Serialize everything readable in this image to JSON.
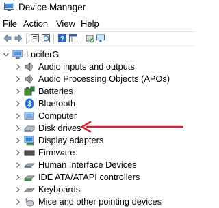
{
  "window": {
    "title": "Device Manager"
  },
  "menu": [
    "File",
    "Action",
    "View",
    "Help"
  ],
  "toolbar": {
    "icons": [
      "back-icon",
      "forward-icon",
      "properties-icon",
      "refresh-icon",
      "help-icon",
      "console-icon",
      "update-driver-icon",
      "monitor-icon"
    ]
  },
  "tree": {
    "root": "LuciferG",
    "items": [
      {
        "label": "Audio inputs and outputs",
        "icon": "speaker-icon"
      },
      {
        "label": "Audio Processing Objects (APOs)",
        "icon": "speaker-icon"
      },
      {
        "label": "Batteries",
        "icon": "battery-icon"
      },
      {
        "label": "Bluetooth",
        "icon": "bluetooth-icon"
      },
      {
        "label": "Computer",
        "icon": "computer-icon"
      },
      {
        "label": "Disk drives",
        "icon": "disk-drive-icon"
      },
      {
        "label": "Display adapters",
        "icon": "display-adapter-icon"
      },
      {
        "label": "Firmware",
        "icon": "firmware-icon"
      },
      {
        "label": "Human Interface Devices",
        "icon": "hid-icon"
      },
      {
        "label": "IDE ATA/ATAPI controllers",
        "icon": "ide-controller-icon"
      },
      {
        "label": "Keyboards",
        "icon": "keyboard-icon"
      },
      {
        "label": "Mice and other pointing devices",
        "icon": "mouse-icon"
      }
    ]
  },
  "colors": {
    "annotation_arrow": "#d42134",
    "accent": "#1e6fd9"
  }
}
